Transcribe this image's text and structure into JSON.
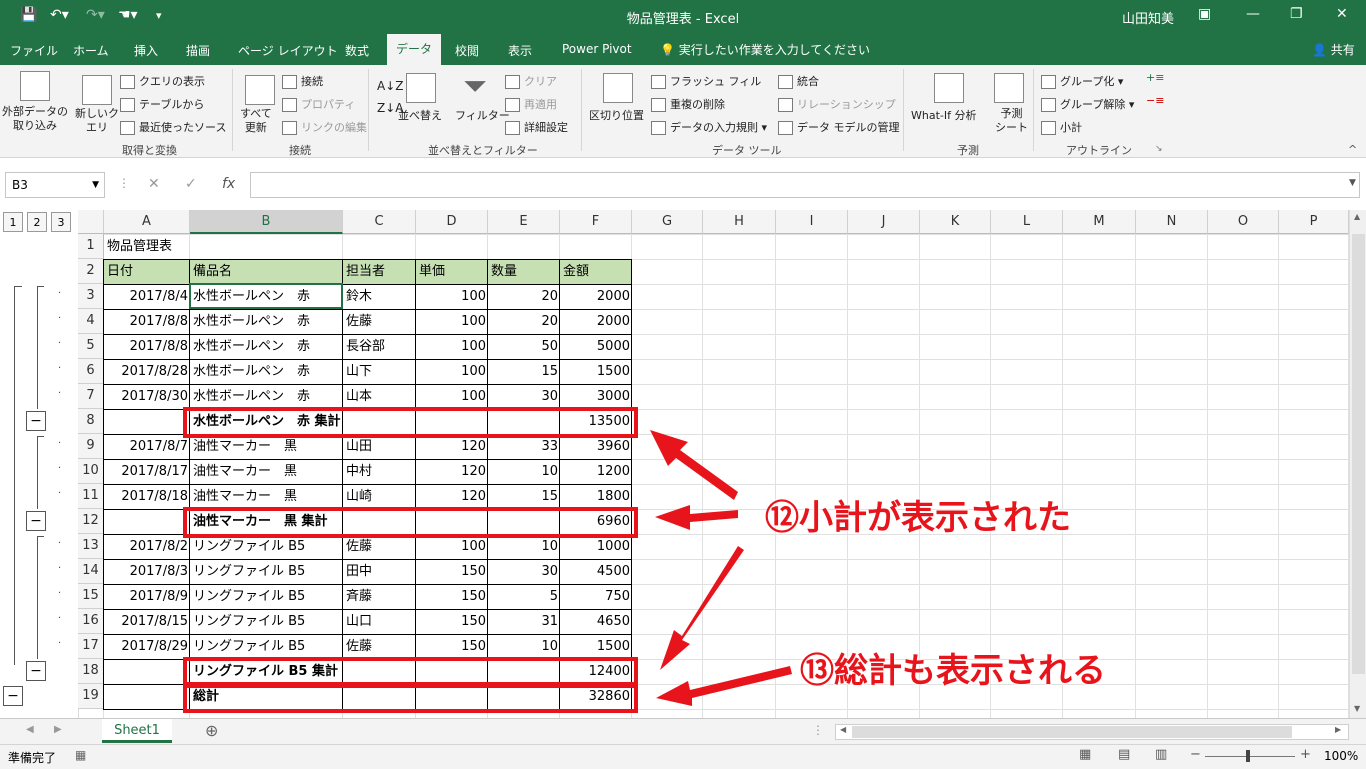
{
  "window": {
    "title": "物品管理表 - Excel",
    "user": "山田知美",
    "qat": [
      "💾",
      "↶▾",
      "↷▾",
      "☚▾",
      "▾"
    ]
  },
  "menu": {
    "tabs": [
      "ファイル",
      "ホーム",
      "挿入",
      "描画",
      "ページ レイアウト",
      "数式",
      "データ",
      "校閲",
      "表示",
      "Power Pivot"
    ],
    "tellme": "実行したい作業を入力してください",
    "share": "共有"
  },
  "ribbon": {
    "get_external": "外部データの\n取り込み",
    "new_query": "新しいク\nエリ",
    "query_show": "クエリの表示",
    "from_table": "テーブルから",
    "recent_sources": "最近使ったソース",
    "group_get": "取得と変換",
    "refresh_all": "すべて\n更新",
    "connections": "接続",
    "properties": "プロパティ",
    "edit_links": "リンクの編集",
    "group_conn": "接続",
    "sort": "並べ替え",
    "filter": "フィルター",
    "clear": "クリア",
    "reapply": "再適用",
    "advanced": "詳細設定",
    "group_sort": "並べ替えとフィルター",
    "text_to_columns": "区切り位置",
    "flash_fill": "フラッシュ フィル",
    "remove_dup": "重複の削除",
    "validation": "データの入力規則",
    "consolidate": "統合",
    "relationships": "リレーションシップ",
    "data_model": "データ モデルの管理",
    "group_tools": "データ ツール",
    "whatif": "What-If 分析",
    "forecast_sheet": "予測\nシート",
    "group_forecast": "予測",
    "group_btn": "グループ化",
    "ungroup_btn": "グループ解除",
    "subtotal_btn": "小計",
    "group_outline": "アウトライン"
  },
  "formula_bar": {
    "name_box": "B3",
    "fx": "fx",
    "value": ""
  },
  "outline_levels": [
    "1",
    "2",
    "3"
  ],
  "columns": [
    "A",
    "B",
    "C",
    "D",
    "E",
    "F",
    "G",
    "H",
    "I",
    "J",
    "K",
    "L",
    "M",
    "N",
    "O",
    "P"
  ],
  "rows": [
    "1",
    "2",
    "3",
    "4",
    "5",
    "6",
    "7",
    "8",
    "9",
    "10",
    "11",
    "12",
    "13",
    "14",
    "15",
    "16",
    "17",
    "18",
    "19"
  ],
  "sheet": {
    "title": "物品管理表",
    "headers": [
      "日付",
      "備品名",
      "担当者",
      "単価",
      "数量",
      "金額"
    ],
    "data": [
      [
        "2017/8/4",
        "水性ボールペン　赤",
        "鈴木",
        "100",
        "20",
        "2000"
      ],
      [
        "2017/8/8",
        "水性ボールペン　赤",
        "佐藤",
        "100",
        "20",
        "2000"
      ],
      [
        "2017/8/8",
        "水性ボールペン　赤",
        "長谷部",
        "100",
        "50",
        "5000"
      ],
      [
        "2017/8/28",
        "水性ボールペン　赤",
        "山下",
        "100",
        "15",
        "1500"
      ],
      [
        "2017/8/30",
        "水性ボールペン　赤",
        "山本",
        "100",
        "30",
        "3000"
      ],
      [
        "",
        "水性ボールペン　赤 集計",
        "",
        "",
        "",
        "13500"
      ],
      [
        "2017/8/7",
        "油性マーカー　黒",
        "山田",
        "120",
        "33",
        "3960"
      ],
      [
        "2017/8/17",
        "油性マーカー　黒",
        "中村",
        "120",
        "10",
        "1200"
      ],
      [
        "2017/8/18",
        "油性マーカー　黒",
        "山崎",
        "120",
        "15",
        "1800"
      ],
      [
        "",
        "油性マーカー　黒 集計",
        "",
        "",
        "",
        "6960"
      ],
      [
        "2017/8/2",
        "リングファイル B5",
        "佐藤",
        "100",
        "10",
        "1000"
      ],
      [
        "2017/8/3",
        "リングファイル B5",
        "田中",
        "150",
        "30",
        "4500"
      ],
      [
        "2017/8/9",
        "リングファイル B5",
        "斉藤",
        "150",
        "5",
        "750"
      ],
      [
        "2017/8/15",
        "リングファイル B5",
        "山口",
        "150",
        "31",
        "4650"
      ],
      [
        "2017/8/29",
        "リングファイル B5",
        "佐藤",
        "150",
        "10",
        "1500"
      ],
      [
        "",
        "リングファイル B5 集計",
        "",
        "",
        "",
        "12400"
      ],
      [
        "",
        "総計",
        "",
        "",
        "",
        "32860"
      ]
    ]
  },
  "annotations": {
    "a12": "⑫小計が表示された",
    "a13": "⑬総計も表示される"
  },
  "sheet_tab": "Sheet1",
  "status": {
    "ready": "準備完了",
    "zoom": "100%"
  },
  "colors": {
    "excel_green": "#217346",
    "header_fill": "#c6e0b4",
    "callout_red": "#e8141c"
  }
}
